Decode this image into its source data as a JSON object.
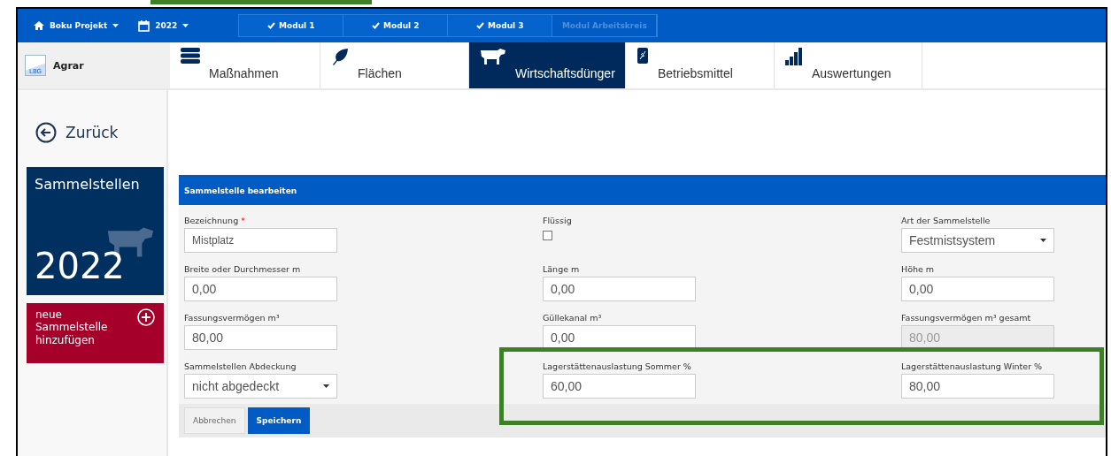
{
  "topbar": {
    "project": "Boku Projekt",
    "year": "2022",
    "modules": [
      {
        "label": "Modul 1",
        "done": true,
        "disabled": false
      },
      {
        "label": "Modul 2",
        "done": true,
        "disabled": false
      },
      {
        "label": "Modul 3",
        "done": true,
        "disabled": false
      },
      {
        "label": "Modul Arbeitskreis",
        "done": false,
        "disabled": true
      }
    ]
  },
  "brand": {
    "logo": "LBG",
    "name": "Agrar"
  },
  "tabs": [
    {
      "label": "Maßnahmen",
      "kind": "list",
      "selected": false
    },
    {
      "label": "Flächen",
      "kind": "leaf",
      "selected": false
    },
    {
      "label": "Wirtschaftsdünger",
      "kind": "cow",
      "selected": true
    },
    {
      "label": "Betriebsmittel",
      "kind": "sack",
      "selected": false
    },
    {
      "label": "Auswertungen",
      "kind": "bars",
      "selected": false
    }
  ],
  "sidebar": {
    "back": "Zurück",
    "tile": {
      "title": "Sammelstellen",
      "year": "2022"
    },
    "add_button": "neue Sammelstelle hinzufügen"
  },
  "form": {
    "title": "Sammelstelle bearbeiten",
    "fields": [
      {
        "label": "Bezeichnung",
        "required_mark": "*",
        "kind": "text",
        "value": "Mistplatz"
      },
      {
        "label": "Flüssig",
        "kind": "checkbox",
        "checked": false
      },
      {
        "label": "Art der Sammelstelle",
        "kind": "select",
        "value": "Festmistsystem"
      },
      {
        "label": "Breite oder Durchmesser m",
        "kind": "text",
        "value": "0,00"
      },
      {
        "label": "Länge m",
        "kind": "text",
        "value": "0,00"
      },
      {
        "label": "Höhe m",
        "kind": "text",
        "value": "0,00"
      },
      {
        "label": "Fassungsvermögen m³",
        "kind": "text",
        "value": "80,00"
      },
      {
        "label": "Güllekanal m³",
        "kind": "text",
        "value": "0,00"
      },
      {
        "label": "Fassungsvermögen m³ gesamt",
        "kind": "readonly",
        "value": "80,00"
      },
      {
        "label": "Sammelstellen Abdeckung",
        "kind": "select",
        "value": "nicht abgedeckt"
      },
      {
        "label": "Lagerstättenauslastung Sommer %",
        "kind": "text",
        "value": "60,00"
      },
      {
        "label": "Lagerstättenauslastung Winter %",
        "kind": "text",
        "value": "80,00"
      }
    ],
    "buttons": [
      {
        "label": "Abbrechen",
        "kind": "secondary"
      },
      {
        "label": "Speichern",
        "kind": "primary"
      }
    ]
  }
}
